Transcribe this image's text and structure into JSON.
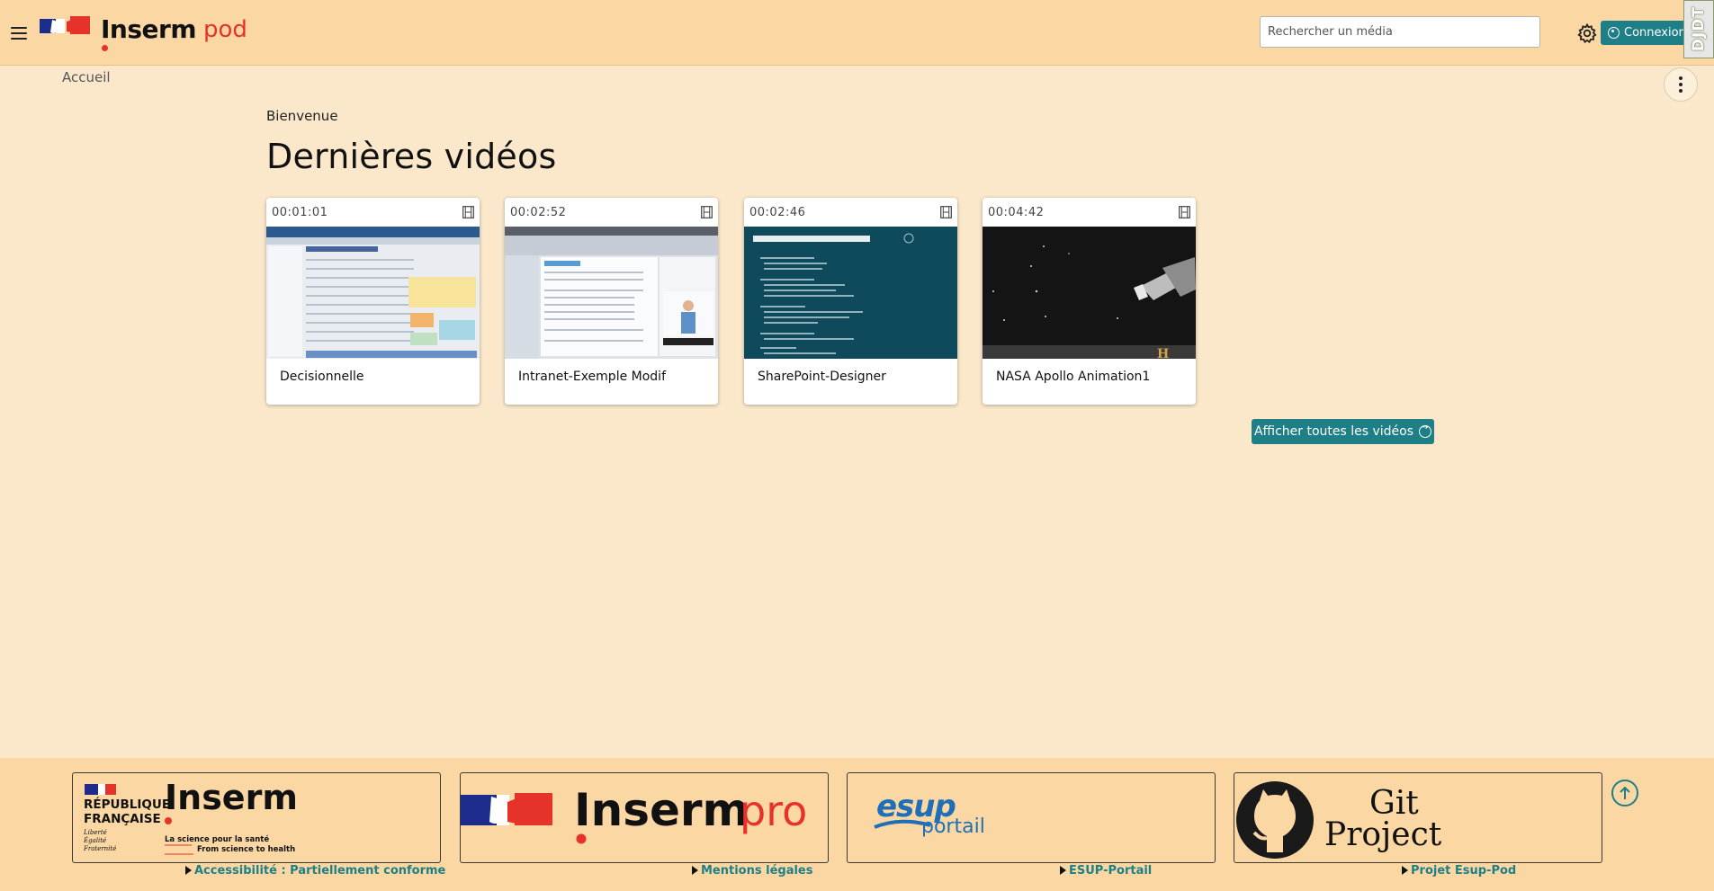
{
  "header": {
    "logo_brand": "Inserm",
    "logo_suffix": "pod",
    "search_placeholder": "Rechercher un média",
    "connexion_label": "Connexion",
    "debug_toolbar_label": "DJDT",
    "colors": {
      "bar": "#fad7a3",
      "accent": "#1f7f86",
      "brand_red": "#e5332a"
    }
  },
  "breadcrumb": {
    "home": "Accueil"
  },
  "main": {
    "welcome": "Bienvenue",
    "title": "Dernières vidéos",
    "videos": [
      {
        "duration": "00:01:01",
        "title": "Decisionnelle",
        "type_icon": "film-icon"
      },
      {
        "duration": "00:02:52",
        "title": "Intranet-Exemple Modif",
        "type_icon": "film-icon"
      },
      {
        "duration": "00:02:46",
        "title": "SharePoint-Designer",
        "type_icon": "film-icon"
      },
      {
        "duration": "00:04:42",
        "title": "NASA Apollo Animation1",
        "type_icon": "film-icon"
      }
    ],
    "show_all_label": "Afficher toutes les vidéos"
  },
  "footer": {
    "logos": [
      {
        "name": "Inserm",
        "line1": "RÉPUBLIQUE",
        "line2": "FRANÇAISE",
        "motto1": "Liberté",
        "motto2": "Égalité",
        "motto3": "Fraternité",
        "tag1": "La science pour la santé",
        "tag2": "From science to health"
      },
      {
        "name": "Inserm",
        "suffix": "pro"
      },
      {
        "name": "esup",
        "suffix": "portail"
      },
      {
        "name": "Git",
        "suffix": "Project"
      }
    ],
    "links": [
      "Accessibilité : Partiellement conforme",
      "Mentions légales",
      "ESUP-Portail",
      "Projet Esup-Pod"
    ]
  }
}
